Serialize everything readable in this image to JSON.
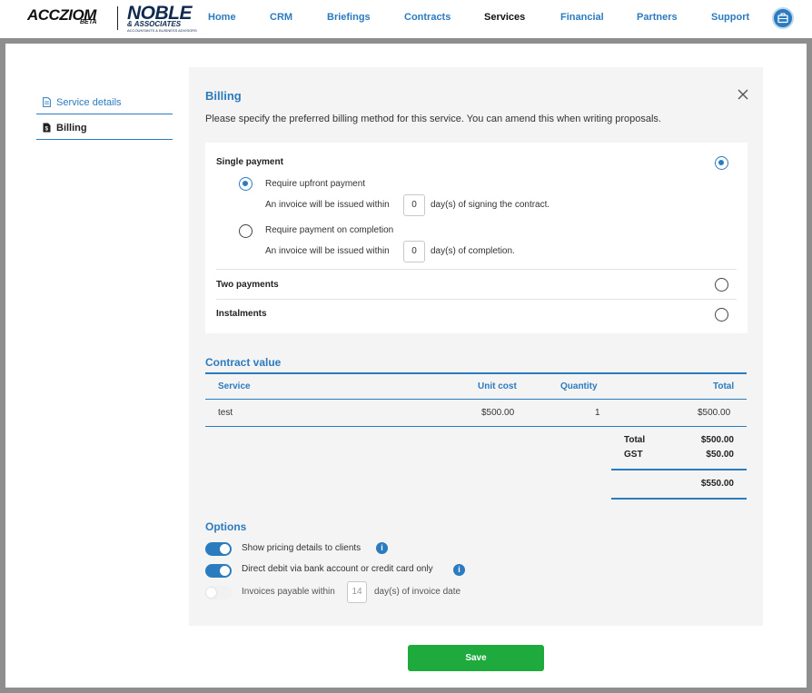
{
  "brand": {
    "name": "ACCZIOM",
    "beta": "BETA",
    "partner_name": "NOBLE",
    "partner_sub": "& ASSOCIATES",
    "partner_tagline": "ACCOUNTANTS & BUSINESS ADVISORS"
  },
  "nav": {
    "items": [
      "Home",
      "CRM",
      "Briefings",
      "Contracts",
      "Services",
      "Financial",
      "Partners",
      "Support"
    ],
    "active": "Services",
    "icon": "briefcase-icon"
  },
  "sidebar": {
    "items": [
      {
        "label": "Service details",
        "icon": "document-icon"
      },
      {
        "label": "Billing",
        "icon": "invoice-icon"
      }
    ]
  },
  "billing": {
    "title": "Billing",
    "description": "Please specify the preferred billing method for this service. You can amend this when writing proposals.",
    "single": {
      "label": "Single payment",
      "upfront_label": "Require upfront payment",
      "upfront_note_pre": "An invoice will be issued within",
      "upfront_days": "0",
      "upfront_note_post": "day(s) of signing the contract.",
      "completion_label": "Require payment on completion",
      "completion_note_pre": "An invoice will be issued within",
      "completion_days": "0",
      "completion_note_post": "day(s) of completion."
    },
    "two_payments": "Two payments",
    "instalments": "Instalments"
  },
  "contract": {
    "title": "Contract value",
    "headers": {
      "service": "Service",
      "unit_cost": "Unit cost",
      "quantity": "Quantity",
      "total": "Total"
    },
    "rows": [
      {
        "service": "test",
        "unit_cost": "$500.00",
        "quantity": "1",
        "total": "$500.00"
      }
    ],
    "total_label": "Total",
    "total_value": "$500.00",
    "gst_label": "GST",
    "gst_value": "$50.00",
    "grand_total": "$550.00"
  },
  "options": {
    "title": "Options",
    "show_pricing": "Show pricing details to clients",
    "direct_debit": "Direct debit via bank account or credit card only",
    "invoices_pre": "Invoices payable within",
    "invoices_days": "14",
    "invoices_post": "day(s) of invoice date",
    "info_glyph": "i"
  },
  "actions": {
    "save": "Save"
  },
  "colors": {
    "accent": "#2b7bbf",
    "save": "#1eaa3d",
    "frame": "#8e8e8e",
    "panel": "#f4f4f4"
  }
}
